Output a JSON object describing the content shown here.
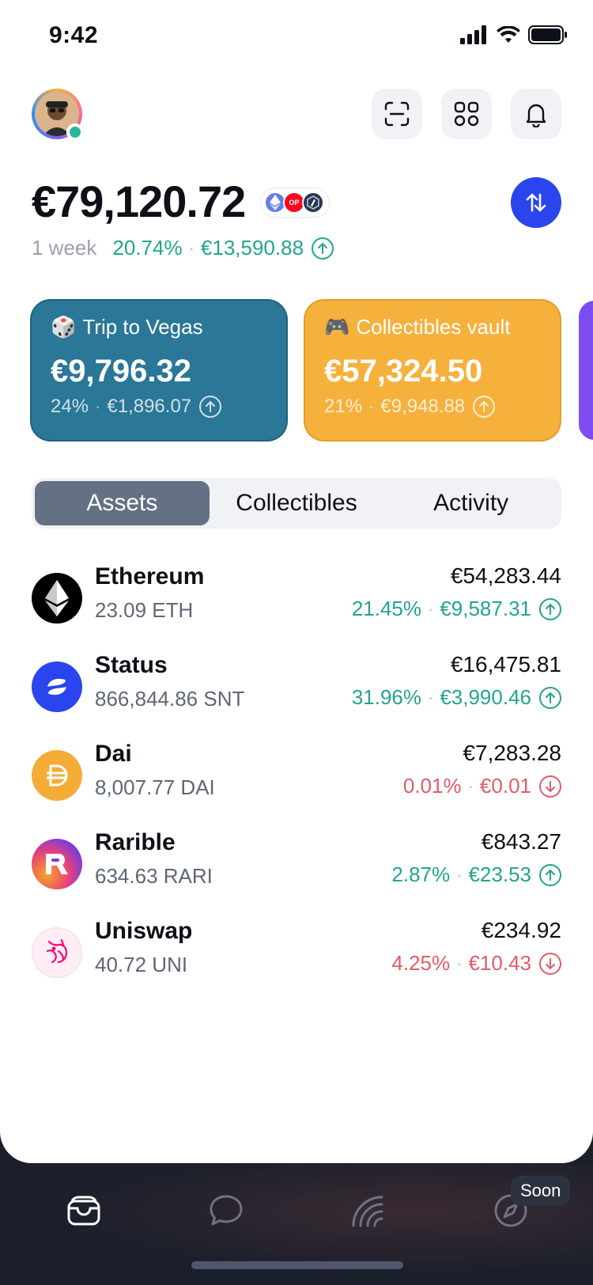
{
  "status_bar": {
    "time": "9:42"
  },
  "wallet": {
    "balance": "€79,120.72",
    "networks": [
      "ethereum-icon",
      "optimism-icon",
      "arbitrum-icon"
    ],
    "optimism_label": "OP",
    "period": "1 week",
    "change_percent": "20.74%",
    "change_amount": "€13,590.88",
    "change_direction": "up"
  },
  "accounts": [
    {
      "emoji": "🎲",
      "name": "Trip to Vegas",
      "amount": "€9,796.32",
      "percent": "24%",
      "change": "€1,896.07",
      "color": "#2a7797"
    },
    {
      "emoji": "🎮",
      "name": "Collectibles vault",
      "amount": "€57,324.50",
      "percent": "21%",
      "change": "€9,948.88",
      "color": "#f6b03c"
    }
  ],
  "tabs": [
    {
      "label": "Assets",
      "active": true
    },
    {
      "label": "Collectibles",
      "active": false
    },
    {
      "label": "Activity",
      "active": false
    }
  ],
  "assets": [
    {
      "name": "Ethereum",
      "qty": "23.09 ETH",
      "value": "€54,283.44",
      "percent": "21.45%",
      "change": "€9,587.31",
      "dir": "up",
      "icon": "ethereum-icon"
    },
    {
      "name": "Status",
      "qty": "866,844.86 SNT",
      "value": "€16,475.81",
      "percent": "31.96%",
      "change": "€3,990.46",
      "dir": "up",
      "icon": "status-icon"
    },
    {
      "name": "Dai",
      "qty": "8,007.77 DAI",
      "value": "€7,283.28",
      "percent": "0.01%",
      "change": "€0.01",
      "dir": "down",
      "icon": "dai-icon"
    },
    {
      "name": "Rarible",
      "qty": "634.63 RARI",
      "value": "€843.27",
      "percent": "2.87%",
      "change": "€23.53",
      "dir": "up",
      "icon": "rarible-icon"
    },
    {
      "name": "Uniswap",
      "qty": "40.72 UNI",
      "value": "€234.92",
      "percent": "4.25%",
      "change": "€10.43",
      "dir": "down",
      "icon": "uniswap-icon"
    }
  ],
  "nav": {
    "soon_badge": "Soon"
  },
  "colors": {
    "up": "#22a58e",
    "down": "#e35b68",
    "accent": "#2a45ee"
  }
}
